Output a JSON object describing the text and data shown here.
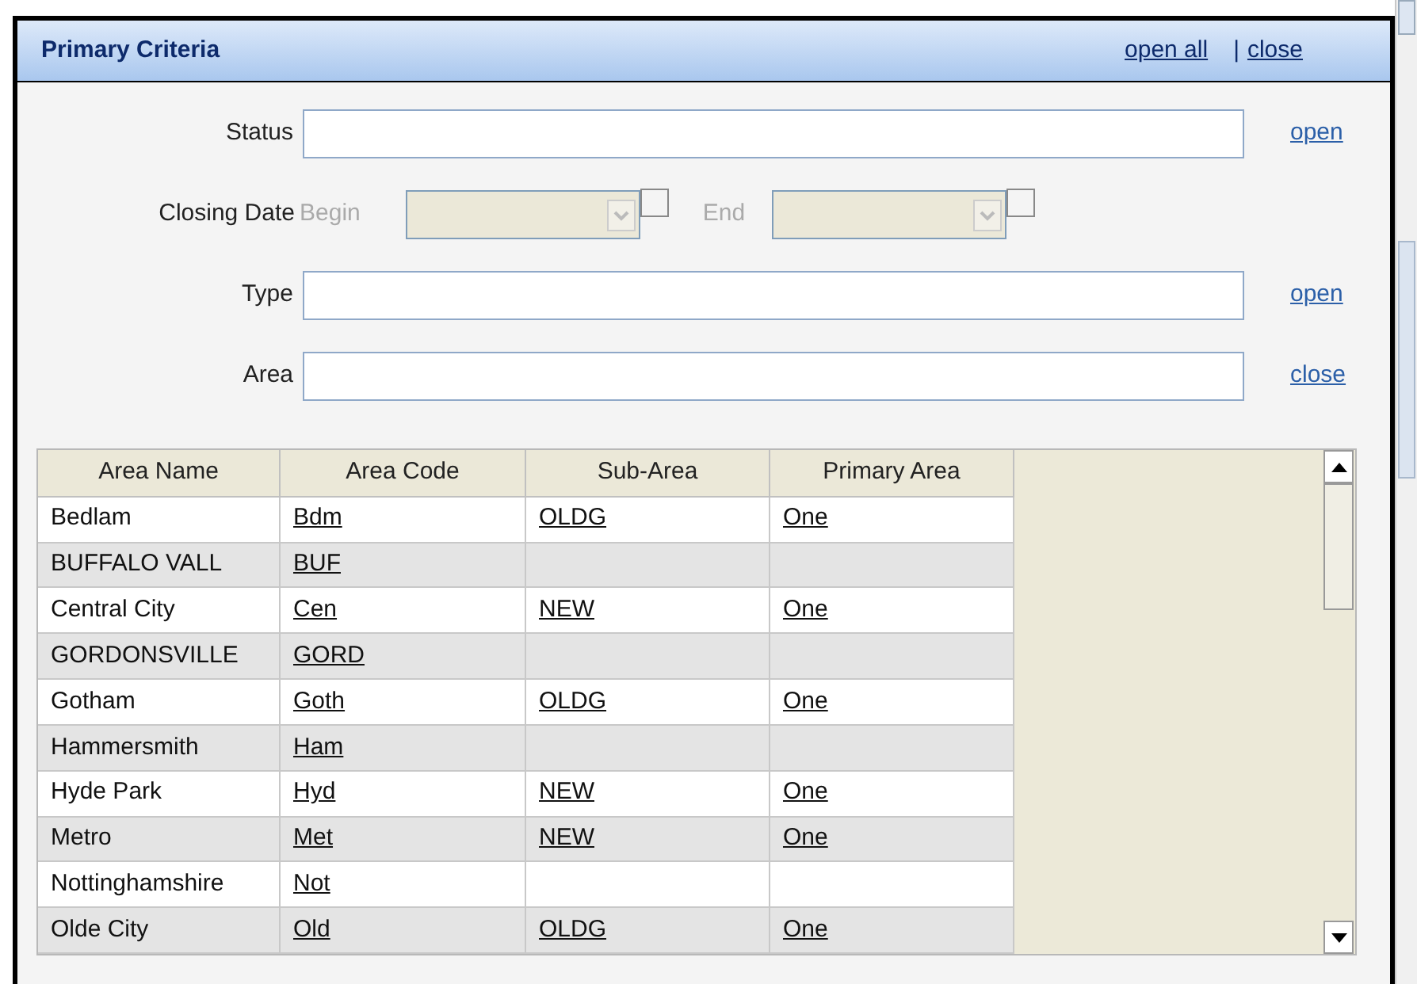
{
  "panel": {
    "title": "Primary Criteria",
    "links": [
      "open all",
      "close"
    ],
    "separator": "|"
  },
  "fields": [
    {
      "kind": "text",
      "label": "Status",
      "link": "open"
    },
    {
      "kind": "daterange",
      "label": "Closing Date",
      "begin_label": "Begin",
      "end_label": "End",
      "disabled": true,
      "begin_checked": false,
      "end_checked": false
    },
    {
      "kind": "text",
      "label": "Type",
      "link": "open"
    },
    {
      "kind": "text",
      "label": "Area",
      "link": "close"
    }
  ],
  "table": {
    "columns": [
      "Area Name",
      "Area Code",
      "Sub-Area",
      "Primary Area"
    ],
    "rows": [
      [
        "Bedlam",
        "Bdm",
        "OLDG",
        "One"
      ],
      [
        "BUFFALO VALL",
        "BUF",
        "",
        ""
      ],
      [
        "Central City",
        "Cen",
        "NEW",
        "One"
      ],
      [
        "GORDONSVILLE",
        "GORD",
        "",
        ""
      ],
      [
        "Gotham",
        "Goth",
        "OLDG",
        "One"
      ],
      [
        "Hammersmith",
        "Ham",
        "",
        ""
      ],
      [
        "Hyde Park",
        "Hyd",
        "NEW",
        "One"
      ],
      [
        "Metro",
        "Met",
        "NEW",
        "One"
      ],
      [
        "Nottinghamshire",
        "Not",
        "",
        ""
      ],
      [
        "Olde City",
        "Old",
        "OLDG",
        "One"
      ]
    ]
  }
}
